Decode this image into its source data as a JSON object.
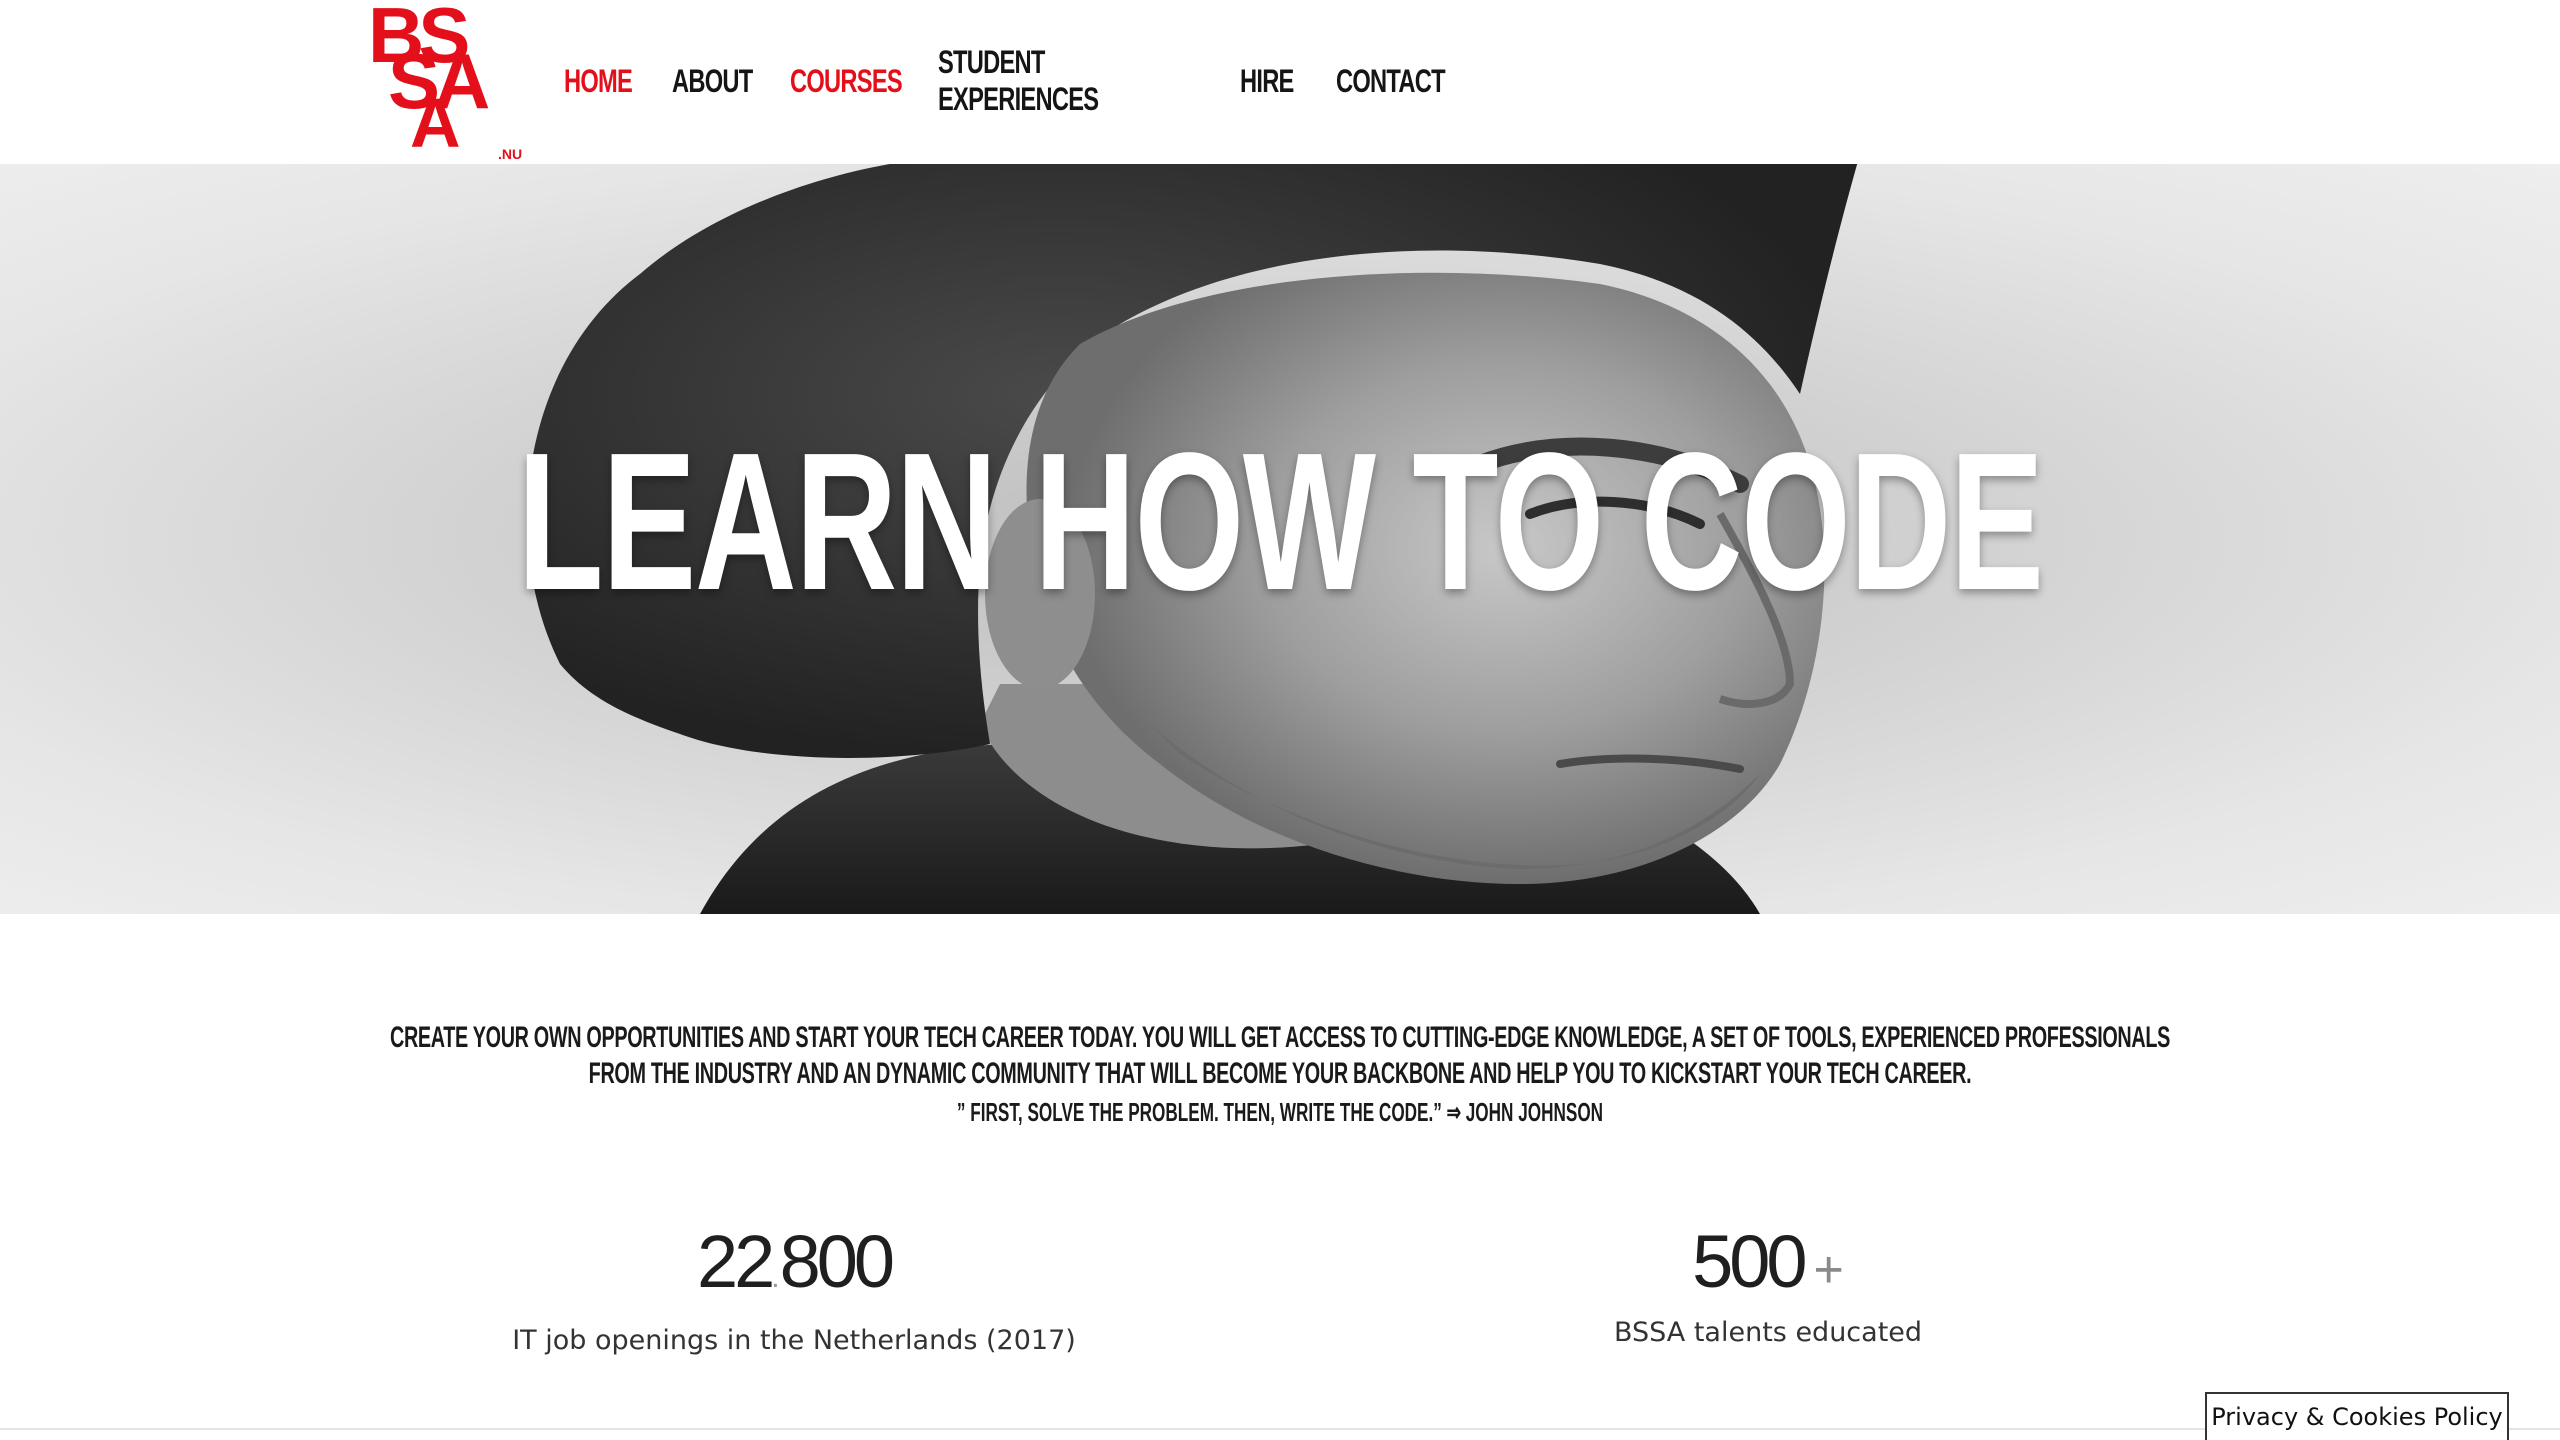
{
  "header": {
    "logo": {
      "text": "BSSA.NU",
      "lines": [
        "BS",
        "SA"
      ],
      "suffix": ".NU",
      "color": "#e3101b"
    },
    "nav": [
      {
        "label": "HOME",
        "active": true
      },
      {
        "label": "ABOUT",
        "active": false
      },
      {
        "label": "COURSES",
        "active": true
      },
      {
        "label": "STUDENT EXPERIENCES",
        "active": false
      },
      {
        "label": "HIRE",
        "active": false
      },
      {
        "label": "CONTACT",
        "active": false
      }
    ],
    "active_color": "#e3101b",
    "text_color": "#151515"
  },
  "hero": {
    "title": "LEARN HOW TO CODE",
    "image": "grayscale photo of a curly-haired man looking to the right"
  },
  "intro": {
    "text": "Create your own opportunities and start your tech career today. You will get access to cutting-edge knowledge, a set of tools, experienced professionals from the industry and an dynamic community that will become your backbone and help you to kickstart your tech career.",
    "quote": "” First, solve the problem. Then, write the code.” ⇒ John Johnson"
  },
  "stats": [
    {
      "number_main": "22",
      "separator": ".",
      "number_rest": "800",
      "suffix": "",
      "label": "IT job openings in the Netherlands (2017)"
    },
    {
      "number_main": "500",
      "separator": "",
      "number_rest": "",
      "suffix": "+",
      "label": "BSSA talents educated"
    }
  ],
  "cookie": {
    "label": "Privacy & Cookies Policy"
  }
}
